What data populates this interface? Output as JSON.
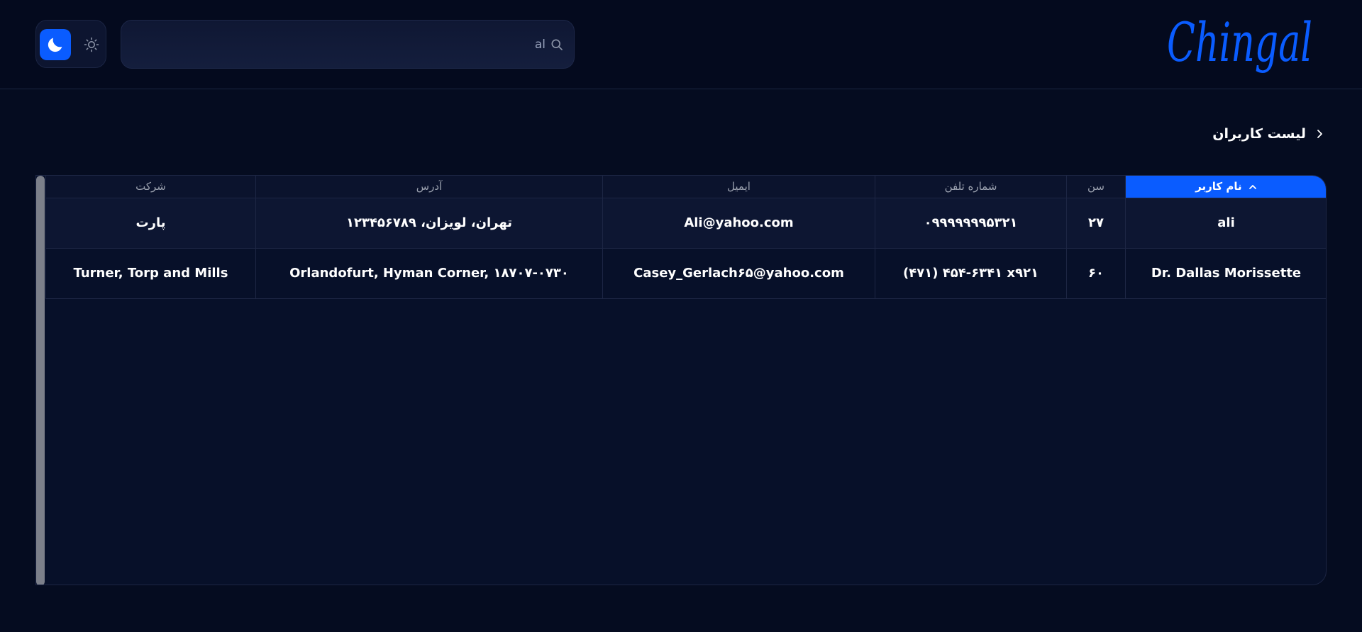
{
  "header": {
    "logo_text": "Chingal",
    "search": {
      "value": "al",
      "placeholder": ""
    },
    "theme": {
      "active": "dark",
      "dark_icon": "moon-icon",
      "light_icon": "sun-icon"
    }
  },
  "breadcrumb": {
    "title": "لیست کاربران",
    "icon": "chevron-right-icon"
  },
  "table": {
    "columns": [
      {
        "key": "username",
        "label": "نام کاربر",
        "sorted": "asc"
      },
      {
        "key": "age",
        "label": "سن"
      },
      {
        "key": "phone",
        "label": "شماره تلفن"
      },
      {
        "key": "email",
        "label": "ایمیل"
      },
      {
        "key": "address",
        "label": "آدرس"
      },
      {
        "key": "company",
        "label": "شرکت"
      }
    ],
    "rows": [
      {
        "username": "ali",
        "age": "۲۷",
        "phone": "۰۹۹۹۹۹۹۹۵۳۲۱",
        "email": "Ali@yahoo.com",
        "address": "تهران، لویزان، ۱۲۳۴۵۶۷۸۹",
        "company": "پارت"
      },
      {
        "username": "Dr. Dallas Morissette",
        "age": "۶۰",
        "phone": "(۴۷۱) ۴۵۴-۶۳۴۱ x۹۲۱",
        "email": "Casey_Gerlach۶۵@yahoo.com",
        "address": "Orlandofurt, Hyman Corner, ۱۸۷۰۷-۰۷۳۰",
        "company": "Turner, Torp and Mills"
      }
    ]
  },
  "colors": {
    "accent": "#0a5cff",
    "background": "#050c20"
  }
}
